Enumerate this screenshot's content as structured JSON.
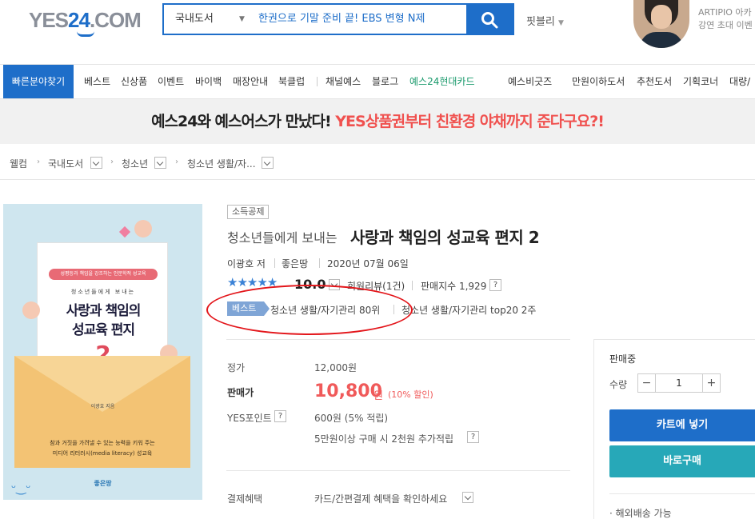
{
  "header": {
    "logo_main": "YES",
    "logo_24": "24",
    "logo_domain": ".COM",
    "search_category": "국내도서",
    "search_query": "한권으로 기말 준비 끝! EBS 변형 N제",
    "publisher_link": "핏블리",
    "promo_line1": "ARTIPIO 아카",
    "promo_line2": "강연 초대 이벤"
  },
  "nav": {
    "quick_find": "빠른분야찾기",
    "left_items": [
      "베스트",
      "신상품",
      "이벤트",
      "바이백",
      "매장안내",
      "북클럽"
    ],
    "mid_items": [
      "채널예스",
      "블로그"
    ],
    "card_item": "예스24현대카드",
    "right_items": [
      "예스비긋즈",
      "만원이하도서",
      "추천도서",
      "기획코너",
      "대량/"
    ]
  },
  "banner": {
    "text_black": "예스24와 예스어스가 만났다! ",
    "text_red": "YES상품권부터 친환경 야채까지 준다구요?!"
  },
  "breadcrumb": [
    "웰컴",
    "국내도서",
    "청소년",
    "청소년 생활/자..."
  ],
  "cover": {
    "pill": "성평등과 책임을 강조하는 인문학적 성교육",
    "subtitle": "청소년들에게 보내는",
    "title_line1": "사랑과 책임의",
    "title_line2": "성교육 편지",
    "number": "2",
    "author": "이광호 지음",
    "caption1": "참과 거짓을 가려낼 수 있는 능력을 키워 주는",
    "caption2": "미디어 리터러시(media literacy) 성교육",
    "publisher": "좋은땅"
  },
  "product": {
    "tax_badge": "소득공제",
    "title_prefix": "청소년들에게 보내는",
    "title_main": "사랑과 책임의 성교육 편지 2",
    "author": "이광호 저",
    "publisher": "좋은땅",
    "date": "2020년 07월 06일",
    "rating": 5,
    "score": "10.0",
    "review": "회원리뷰(1건)",
    "sales_index": "판매지수 1,929",
    "best_badge": "베스트",
    "rank1": "청소년 생활/자기관리 80위",
    "rank2": "청소년 생활/자기관리 top20 2주"
  },
  "price": {
    "list_label": "정가",
    "list_value": "12,000원",
    "sale_label": "판매가",
    "sale_value": "10,800",
    "sale_unit": "원",
    "discount": "(10% 할인)",
    "point_label": "YES포인트",
    "point_value": "600원 (5% 적립)",
    "point_extra": "5만원이상 구매 시 2천원 추가적립",
    "pay_label": "결제혜택",
    "pay_value": "카드/간편결제 혜택을 확인하세요"
  },
  "buy": {
    "state": "판매중",
    "qty_label": "수량",
    "qty": "1",
    "minus": "−",
    "plus": "+",
    "cart": "카트에 넣기",
    "buy_now": "바로구매",
    "shipping": "· 해외배송 가능"
  },
  "colors": {
    "brand_blue": "#1e6ec9",
    "price_red": "#f05a5a",
    "buy_teal": "#27a8b8",
    "annotation_red": "#e3161b"
  }
}
